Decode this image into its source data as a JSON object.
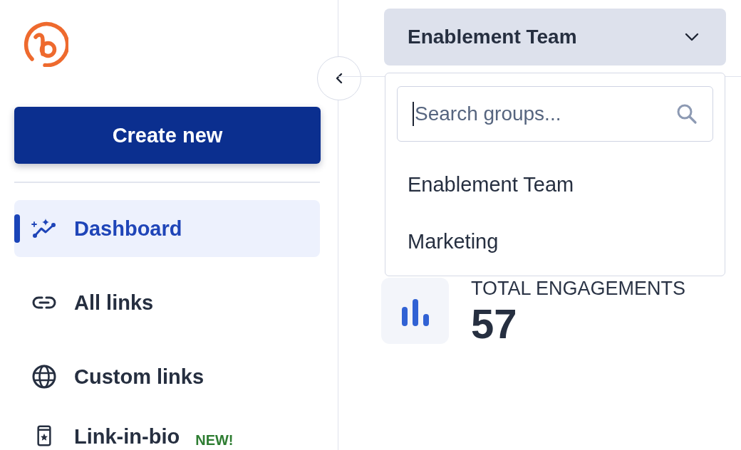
{
  "sidebar": {
    "create_button": "Create new",
    "nav": [
      {
        "label": "Dashboard",
        "selected": true
      },
      {
        "label": "All links",
        "selected": false
      },
      {
        "label": "Custom links",
        "selected": false
      },
      {
        "label": "Link-in-bio",
        "selected": false,
        "badge": "NEW!"
      }
    ]
  },
  "group_selector": {
    "value": "Enablement Team",
    "expanded": true,
    "search": {
      "placeholder": "Search groups...",
      "focused": true
    },
    "options": [
      "Enablement Team",
      "Marketing"
    ]
  },
  "stats": [
    {
      "label": "TOTAL ENGAGEMENTS",
      "value": "57"
    }
  ]
}
